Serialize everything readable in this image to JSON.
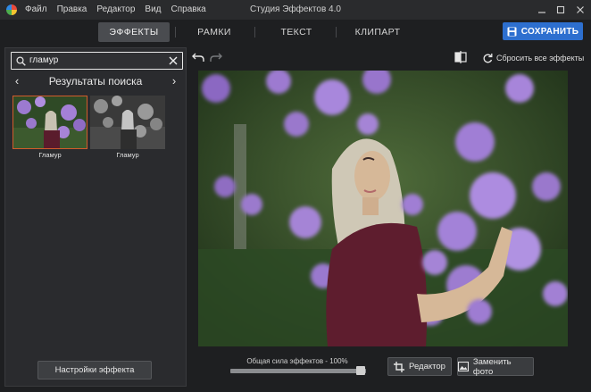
{
  "menu": [
    "Файл",
    "Правка",
    "Редактор",
    "Вид",
    "Справка"
  ],
  "window_title": "Студия Эффектов 4.0",
  "tabs": [
    {
      "label": "ЭФФЕКТЫ",
      "active": true
    },
    {
      "label": "РАМКИ",
      "active": false
    },
    {
      "label": "ТЕКСТ",
      "active": false
    },
    {
      "label": "КЛИПАРТ",
      "active": false
    }
  ],
  "save_label": "СОХРАНИТЬ",
  "search": {
    "value": "гламур"
  },
  "results_title": "Результаты поиска",
  "thumbnails": [
    {
      "label": "Гламур",
      "selected": true
    },
    {
      "label": "Гламур",
      "selected": false
    }
  ],
  "effect_settings_label": "Настройки эффекта",
  "reset_label": "Сбросить все эффекты",
  "strength": {
    "label": "Общая сила эффектов - 100%",
    "value": 100
  },
  "editor_label": "Редактор",
  "replace_photo_label": "Заменить фото",
  "colors": {
    "accent": "#2d6fcf",
    "selection": "#d35b2b",
    "bg": "#1e1f21"
  }
}
